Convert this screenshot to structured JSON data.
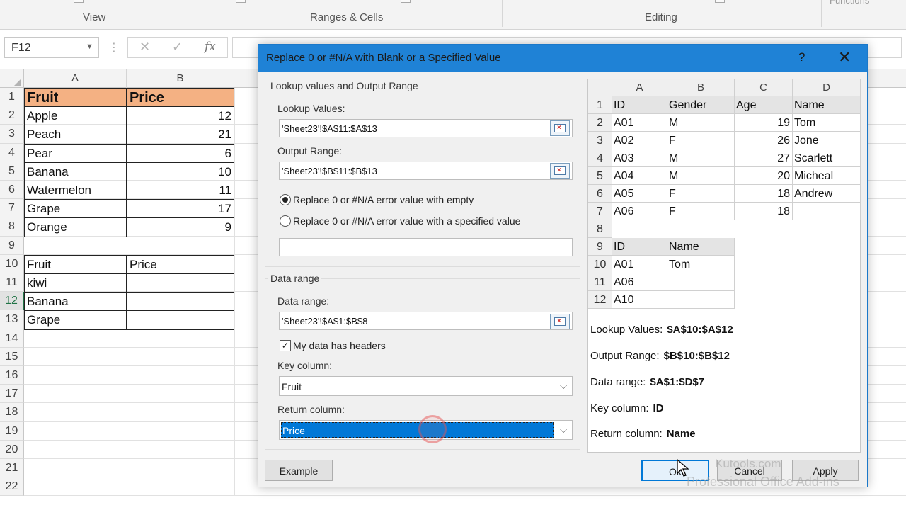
{
  "ribbon": {
    "groups": [
      {
        "label": "View"
      },
      {
        "label": "Ranges & Cells"
      },
      {
        "label": "Editing"
      }
    ],
    "functions_label": "Functions"
  },
  "formula_bar": {
    "name_box": "F12",
    "cancel_icon": "close-icon",
    "enter_icon": "check-icon",
    "function_icon": "fx",
    "value": ""
  },
  "sheet": {
    "columns": [
      "A",
      "B"
    ],
    "rows": [
      "1",
      "2",
      "3",
      "4",
      "5",
      "6",
      "7",
      "8",
      "9",
      "10",
      "11",
      "12",
      "13",
      "14",
      "15",
      "16",
      "17",
      "18",
      "19",
      "20",
      "21",
      "22"
    ],
    "active_row": "12",
    "table1": {
      "headers": [
        "Fruit",
        "Price"
      ],
      "rows": [
        [
          "Apple",
          "12"
        ],
        [
          "Peach",
          "21"
        ],
        [
          "Pear",
          "6"
        ],
        [
          "Banana",
          "10"
        ],
        [
          "Watermelon",
          "11"
        ],
        [
          "Grape",
          "17"
        ],
        [
          "Orange",
          "9"
        ]
      ]
    },
    "table2": {
      "headers": [
        "Fruit",
        "Price"
      ],
      "rows": [
        [
          "kiwi",
          ""
        ],
        [
          "Banana",
          ""
        ],
        [
          "Grape",
          ""
        ]
      ]
    },
    "header_fill_color": "#f4b183"
  },
  "dialog": {
    "title": "Replace 0 or #N/A with Blank or a Specified Value",
    "help": "?",
    "close": "✕",
    "lookup_group": {
      "label": "Lookup values and Output Range",
      "lookup_values_label": "Lookup Values:",
      "lookup_values": "'Sheet23'!$A$11:$A$13",
      "output_range_label": "Output Range:",
      "output_range": "'Sheet23'!$B$11:$B$13",
      "radio_empty_label": "Replace 0 or #N/A error value with empty",
      "radio_empty_checked": true,
      "radio_specified_label": "Replace 0 or #N/A error value with a specified value",
      "radio_specified_checked": false,
      "specified_value": ""
    },
    "data_group": {
      "label": "Data range",
      "data_range_label": "Data range:",
      "data_range": "'Sheet23'!$A$1:$B$8",
      "headers_label": "My data has headers",
      "headers_checked": true,
      "key_column_label": "Key column:",
      "key_column": "Fruit",
      "return_column_label": "Return column:",
      "return_column": "Price"
    },
    "buttons": {
      "example": "Example",
      "ok": "Ok",
      "cancel": "Cancel",
      "apply": "Apply"
    },
    "preview": {
      "columns": [
        "A",
        "B",
        "C",
        "D"
      ],
      "rows": [
        "1",
        "2",
        "3",
        "4",
        "5",
        "6",
        "7",
        "8",
        "9",
        "10",
        "11",
        "12"
      ],
      "table1": [
        [
          "ID",
          "Gender",
          "Age",
          "Name"
        ],
        [
          "A01",
          "M",
          "19",
          "Tom"
        ],
        [
          "A02",
          "F",
          "26",
          "Jone"
        ],
        [
          "A03",
          "M",
          "27",
          "Scarlett"
        ],
        [
          "A04",
          "M",
          "20",
          "Micheal"
        ],
        [
          "A05",
          "F",
          "18",
          "Andrew"
        ],
        [
          "A06",
          "F",
          "18",
          ""
        ]
      ],
      "table2": [
        [
          "ID",
          "Name"
        ],
        [
          "A01",
          "Tom"
        ],
        [
          "A06",
          ""
        ],
        [
          "A10",
          ""
        ]
      ],
      "info": {
        "lookup_label": "Lookup Values:",
        "lookup_value": "$A$10:$A$12",
        "output_label": "Output Range:",
        "output_value": "$B$10:$B$12",
        "data_label": "Data range:",
        "data_value": "$A$1:$D$7",
        "key_label": "Key column:",
        "key_value": "ID",
        "return_label": "Return column:",
        "return_value": "Name"
      }
    }
  },
  "watermark": {
    "line1": "Kutools.com",
    "line2": "Professional Office Add-ins"
  }
}
